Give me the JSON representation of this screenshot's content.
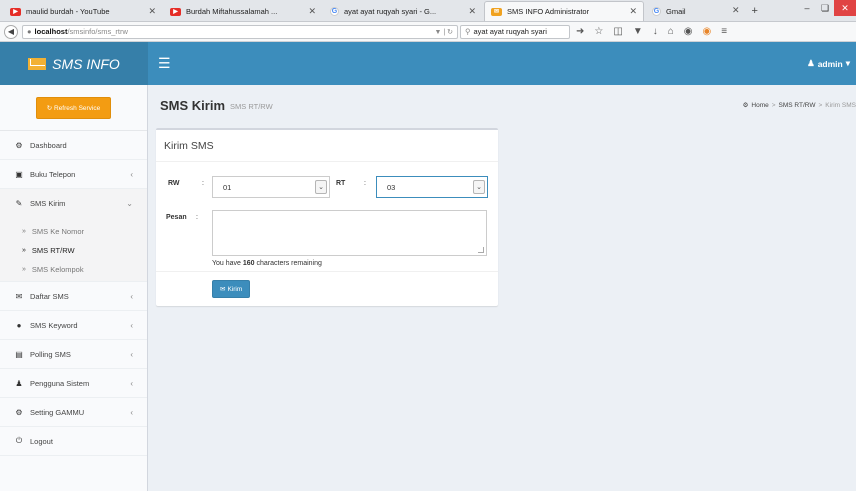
{
  "browser": {
    "tabs": [
      {
        "title": "maulid burdah - YouTube",
        "icon": "youtube-icon"
      },
      {
        "title": "Burdah Miftahussalamah ...",
        "icon": "youtube-icon"
      },
      {
        "title": "ayat ayat ruqyah syari - G...",
        "icon": "google-icon"
      },
      {
        "title": "SMS INFO Administrator",
        "icon": "sms-icon"
      },
      {
        "title": "Gmail",
        "icon": "google-icon"
      }
    ],
    "url_host": "localhost",
    "url_path": "/smsinfo/sms_rtrw",
    "search_text": "ayat ayat ruqyah syari"
  },
  "app": {
    "logo_text": "SMS INFO",
    "user_label": "admin"
  },
  "sidebar": {
    "refresh_label": "Refresh Service",
    "items": [
      {
        "label": "Dashboard",
        "icon": "dashboard-icon"
      },
      {
        "label": "Buku Telepon",
        "icon": "book-icon"
      },
      {
        "label": "SMS Kirim",
        "icon": "edit-icon"
      },
      {
        "label": "Daftar SMS",
        "icon": "envelope-icon"
      },
      {
        "label": "SMS Keyword",
        "icon": "comment-icon"
      },
      {
        "label": "Polling SMS",
        "icon": "chart-icon"
      },
      {
        "label": "Pengguna Sistem",
        "icon": "user-icon"
      },
      {
        "label": "Setting GAMMU",
        "icon": "gear-icon"
      },
      {
        "label": "Logout",
        "icon": "power-icon"
      }
    ],
    "subitems": [
      {
        "label": "SMS Ke Nomor"
      },
      {
        "label": "SMS RT/RW"
      },
      {
        "label": "SMS Kelompok"
      }
    ]
  },
  "page": {
    "title": "SMS Kirim",
    "subtitle": "SMS RT/RW",
    "breadcrumb": [
      "Home",
      "SMS RT/RW",
      "Kirim SMS"
    ]
  },
  "form": {
    "box_title": "Kirim SMS",
    "rw_label": "RW",
    "rw_value": "01",
    "rt_label": "RT",
    "rt_value": "03",
    "pesan_label": "Pesan",
    "pesan_value": "",
    "remaining_prefix": "You have",
    "remaining_count": "160",
    "remaining_suffix": "characters remaining",
    "submit_label": "Kirim"
  }
}
